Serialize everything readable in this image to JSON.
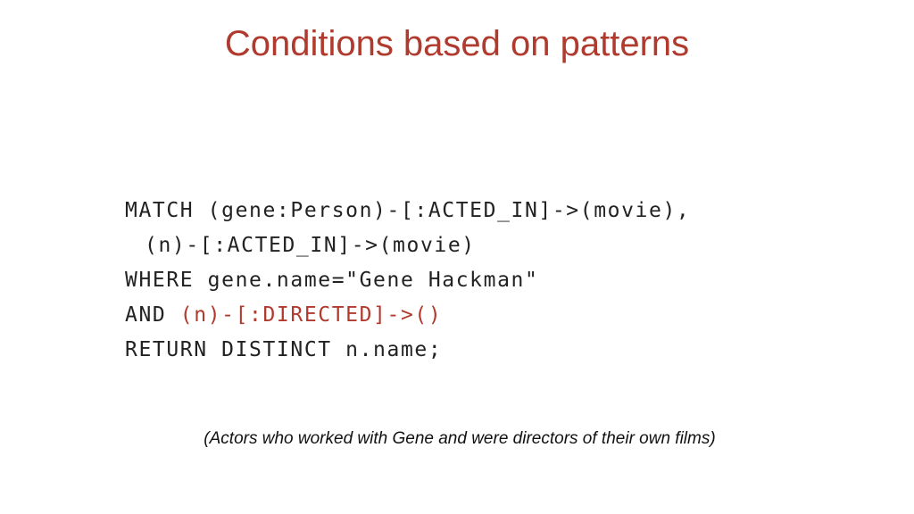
{
  "slide": {
    "title": "Conditions based on patterns",
    "code_lines": [
      "MATCH (gene:Person)-[:ACTED_IN]->(movie),",
      "(n)-[:ACTED_IN]->(movie)",
      "WHERE gene.name=\"Gene Hackman\""
    ],
    "and_line": {
      "keyword": "AND ",
      "pattern": "(n)-[:DIRECTED]->()"
    },
    "return_line": "RETURN DISTINCT n.name;",
    "caption": "(Actors who worked with Gene and were directors of their own films)"
  },
  "colors": {
    "title": "#b03a2e",
    "highlight": "#b03a2e",
    "code_text": "#222222",
    "background": "#ffffff"
  }
}
